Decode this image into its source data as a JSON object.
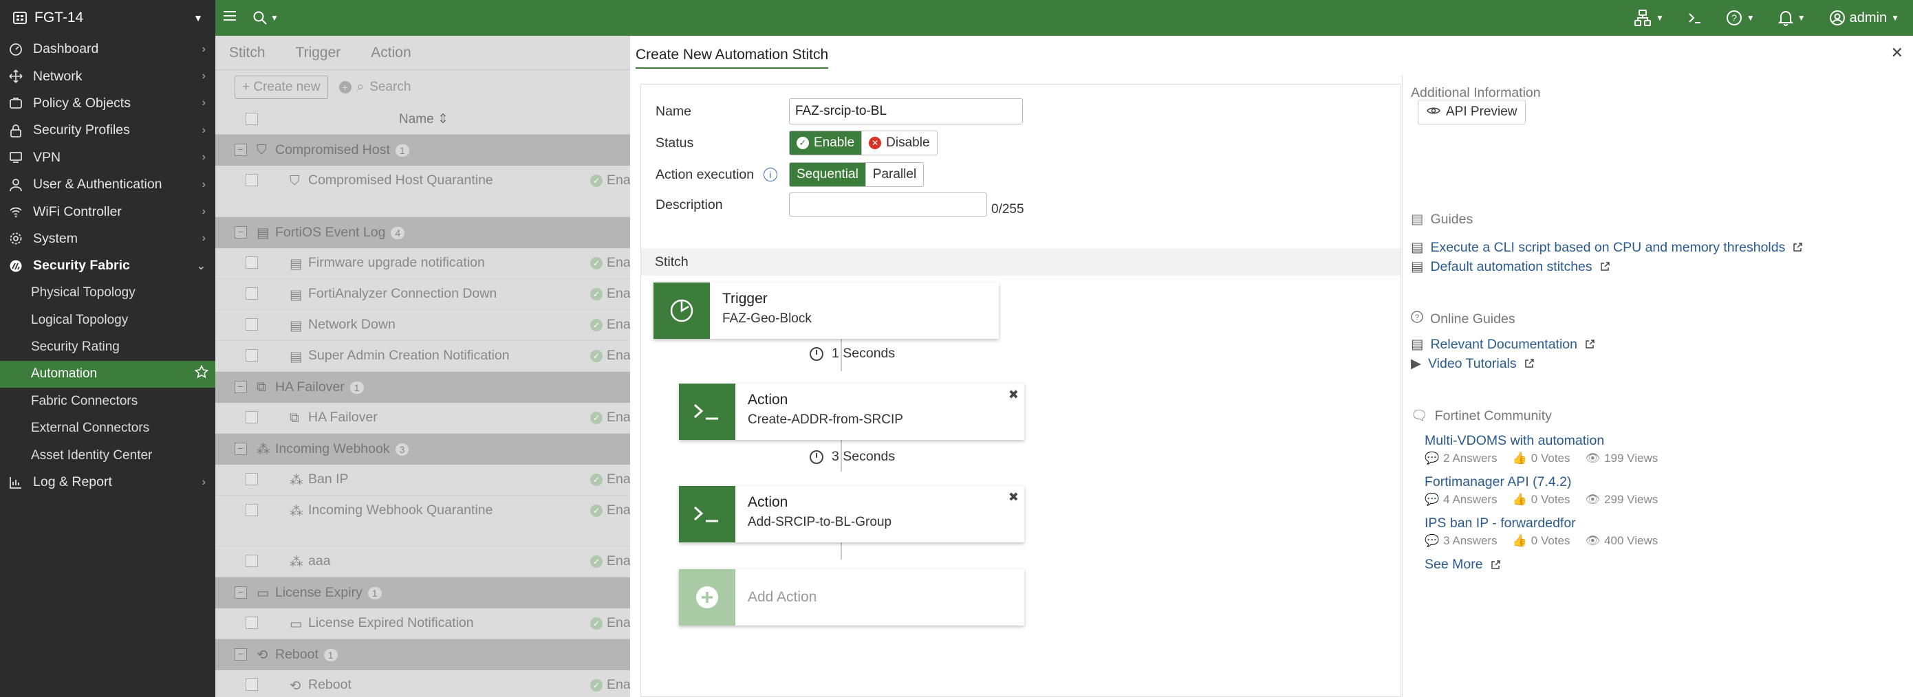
{
  "device": {
    "name": "FGT-14"
  },
  "sidebar": {
    "items": [
      {
        "label": "Dashboard"
      },
      {
        "label": "Network"
      },
      {
        "label": "Policy & Objects"
      },
      {
        "label": "Security Profiles"
      },
      {
        "label": "VPN"
      },
      {
        "label": "User & Authentication"
      },
      {
        "label": "WiFi Controller"
      },
      {
        "label": "System"
      },
      {
        "label": "Security Fabric"
      }
    ],
    "sub_items": [
      {
        "label": "Physical Topology"
      },
      {
        "label": "Logical Topology"
      },
      {
        "label": "Security Rating"
      },
      {
        "label": "Automation"
      },
      {
        "label": "Fabric Connectors"
      },
      {
        "label": "External Connectors"
      },
      {
        "label": "Asset Identity Center"
      }
    ],
    "last_item": {
      "label": "Log & Report"
    }
  },
  "topbar": {
    "user": "admin"
  },
  "list": {
    "tabs": [
      "Stitch",
      "Trigger",
      "Action"
    ],
    "create_label": "Create new",
    "search_placeholder": "Search",
    "name_header": "Name",
    "status_text": "Ena",
    "groups": [
      {
        "label": "Compromised Host",
        "count": "1",
        "rows": [
          "Compromised Host Quarantine"
        ]
      },
      {
        "label": "FortiOS Event Log",
        "count": "4",
        "rows": [
          "Firmware upgrade notification",
          "FortiAnalyzer Connection Down",
          "Network Down",
          "Super Admin Creation Notification"
        ]
      },
      {
        "label": "HA Failover",
        "count": "1",
        "rows": [
          "HA Failover"
        ]
      },
      {
        "label": "Incoming Webhook",
        "count": "3",
        "rows": [
          "Ban IP",
          "Incoming Webhook Quarantine",
          "aaa"
        ]
      },
      {
        "label": "License Expiry",
        "count": "1",
        "rows": [
          "License Expired Notification"
        ]
      },
      {
        "label": "Reboot",
        "count": "1",
        "rows": [
          "Reboot"
        ]
      }
    ]
  },
  "modal": {
    "title": "Create New Automation Stitch",
    "form": {
      "name_label": "Name",
      "name_value": "FAZ-srcip-to-BL",
      "status_label": "Status",
      "enable_label": "Enable",
      "disable_label": "Disable",
      "exec_label": "Action execution",
      "sequential_label": "Sequential",
      "parallel_label": "Parallel",
      "description_label": "Description",
      "description_counter": "0/255"
    },
    "stitch": {
      "section_label": "Stitch",
      "trigger": {
        "type": "Trigger",
        "name": "FAZ-Geo-Block"
      },
      "delay1": "1 Seconds",
      "action1": {
        "type": "Action",
        "name": "Create-ADDR-from-SRCIP"
      },
      "delay2": "3 Seconds",
      "action2": {
        "type": "Action",
        "name": "Add-SRCIP-to-BL-Group"
      },
      "add_action": "Add Action"
    },
    "info": {
      "additional": "Additional Information",
      "api_preview": "API Preview",
      "guides_label": "Guides",
      "guide1": "Execute a CLI script based on CPU and memory thresholds",
      "guide2": "Default automation stitches",
      "online_label": "Online Guides",
      "online1": "Relevant Documentation",
      "online2": "Video Tutorials",
      "community_label": "Fortinet Community",
      "posts": [
        {
          "title": "Multi-VDOMS with automation",
          "answers": "2 Answers",
          "votes": "0 Votes",
          "views": "199 Views"
        },
        {
          "title": "Fortimanager API (7.4.2)",
          "answers": "4 Answers",
          "votes": "0 Votes",
          "views": "299 Views"
        },
        {
          "title": "IPS ban IP - forwardedfor",
          "answers": "3 Answers",
          "votes": "0 Votes",
          "views": "400 Views"
        }
      ],
      "see_more": "See More"
    }
  }
}
